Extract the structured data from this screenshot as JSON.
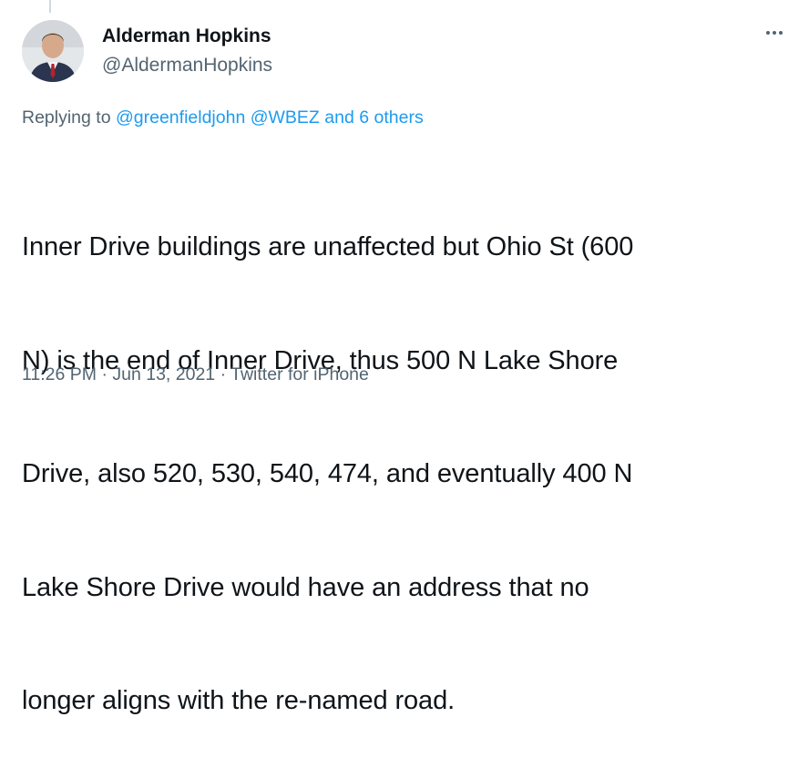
{
  "author": {
    "display_name": "Alderman Hopkins",
    "handle": "@AldermanHopkins"
  },
  "more_icon": "more-horizontal-icon",
  "replying": {
    "prefix": "Replying to",
    "mentions": [
      "@greenfieldjohn",
      "@WBEZ"
    ],
    "joiner": "and",
    "others": "6 others"
  },
  "tweet": {
    "lines": [
      "Inner Drive buildings are unaffected but Ohio St (600",
      "N) is the end of Inner Drive, thus 500 N Lake Shore",
      "Drive, also 520, 530, 540, 474, and eventually 400 N",
      "Lake Shore Drive would have an address that no",
      "longer aligns with the re-named road."
    ]
  },
  "meta": {
    "time": "11:26 PM",
    "separator": "·",
    "date": "Jun 13, 2021",
    "source": "Twitter for iPhone"
  }
}
